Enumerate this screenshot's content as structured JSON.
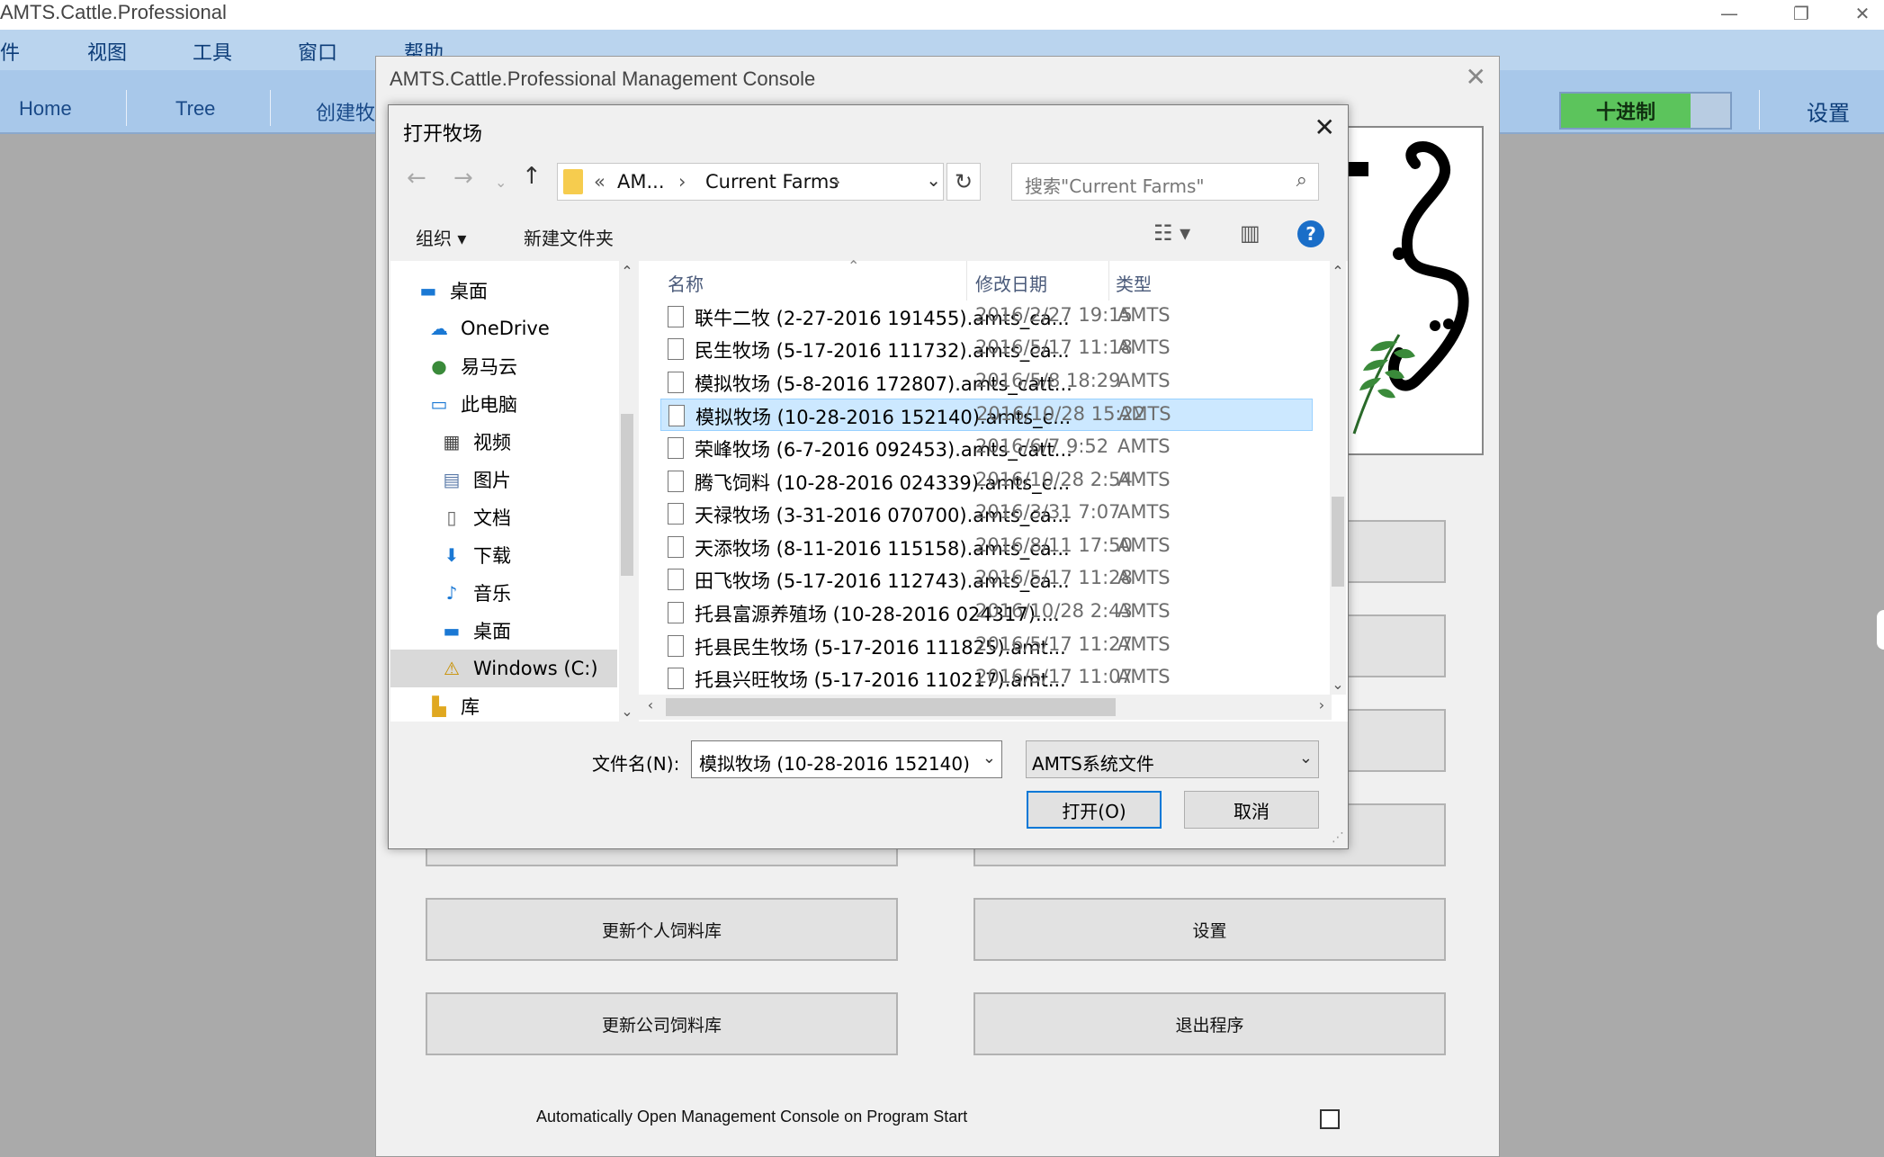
{
  "app": {
    "title": "AMTS.Cattle.Professional",
    "window_controls": {
      "minimize": "—",
      "restore": "❐",
      "close": "✕"
    },
    "menu": [
      "件",
      "视图",
      "工具",
      "窗口",
      "帮助"
    ],
    "nav": [
      "Home",
      "Tree",
      "创建牧"
    ],
    "toggle_label": "十进制",
    "settings_label": "设置"
  },
  "console": {
    "title": "AMTS.Cattle.Professional Management Console",
    "close": "✕",
    "buttons": {
      "update_personal_feed": "更新个人饲料库",
      "settings": "设置",
      "update_company_feed": "更新公司饲料库",
      "exit": "退出程序"
    },
    "auto_open_label": "Automatically Open Management Console on Program Start",
    "auto_open_checked": false
  },
  "dialog": {
    "title": "打开牧场",
    "close": "✕",
    "breadcrumb": {
      "prefix": "«",
      "parent": "AM...",
      "current": "Current Farms"
    },
    "search_placeholder": "搜索\"Current Farms\"",
    "toolbar": {
      "organize": "组织 ▾",
      "new_folder": "新建文件夹",
      "help": "?"
    },
    "nav_items": [
      {
        "label": "桌面",
        "icon": "desktop-icon"
      },
      {
        "label": "OneDrive",
        "icon": "onedrive-icon"
      },
      {
        "label": "易马云",
        "icon": "user-icon"
      },
      {
        "label": "此电脑",
        "icon": "computer-icon"
      },
      {
        "label": "视频",
        "icon": "video-icon"
      },
      {
        "label": "图片",
        "icon": "picture-icon"
      },
      {
        "label": "文档",
        "icon": "document-icon"
      },
      {
        "label": "下载",
        "icon": "download-icon"
      },
      {
        "label": "音乐",
        "icon": "music-icon"
      },
      {
        "label": "桌面",
        "icon": "desktop-icon"
      },
      {
        "label": "Windows (C:)",
        "icon": "drive-icon"
      },
      {
        "label": "库",
        "icon": "library-icon"
      }
    ],
    "columns": {
      "name": "名称",
      "date": "修改日期",
      "type": "类型"
    },
    "files": [
      {
        "name": "联牛二牧 (2-27-2016 191455).amts_ca...",
        "date": "2016/2/27 19:15",
        "type": "AMTS"
      },
      {
        "name": "民生牧场 (5-17-2016 111732).amts_ca...",
        "date": "2016/5/17 11:18",
        "type": "AMTS"
      },
      {
        "name": "模拟牧场 (5-8-2016 172807).amts_catt...",
        "date": "2016/5/8 18:29",
        "type": "AMTS"
      },
      {
        "name": "模拟牧场 (10-28-2016 152140).amts_c...",
        "date": "2016/10/28 15:22",
        "type": "AMTS"
      },
      {
        "name": "荣峰牧场 (6-7-2016 092453).amts_catt...",
        "date": "2016/6/7 9:52",
        "type": "AMTS"
      },
      {
        "name": "腾飞饲料 (10-28-2016 024339).amts_c...",
        "date": "2016/10/28 2:54",
        "type": "AMTS"
      },
      {
        "name": "天禄牧场 (3-31-2016 070700).amts_ca...",
        "date": "2016/3/31 7:07",
        "type": "AMTS"
      },
      {
        "name": "天添牧场 (8-11-2016 115158).amts_ca...",
        "date": "2016/8/11 17:50",
        "type": "AMTS"
      },
      {
        "name": "田飞牧场 (5-17-2016 112743).amts_ca...",
        "date": "2016/5/17 11:28",
        "type": "AMTS"
      },
      {
        "name": "托县富源养殖场 (10-28-2016 024317)....",
        "date": "2016/10/28 2:43",
        "type": "AMTS"
      },
      {
        "name": "托县民生牧场 (5-17-2016 111825).amt...",
        "date": "2016/5/17 11:27",
        "type": "AMTS"
      },
      {
        "name": "托县兴旺牧场 (5-17-2016 110217).amt...",
        "date": "2016/5/17 11:07",
        "type": "AMTS"
      }
    ],
    "selected_index": 3,
    "filename_label": "文件名(N):",
    "filename_value": "模拟牧场 (10-28-2016 152140).",
    "filetype_value": "AMTS系统文件",
    "open_label": "打开(O)",
    "cancel_label": "取消"
  },
  "colors": {
    "menubar": "#bad4ee",
    "navbar": "#a8c8ea",
    "toggle_on": "#5cc45c",
    "selection": "#cce8ff",
    "accent": "#0078d7"
  }
}
